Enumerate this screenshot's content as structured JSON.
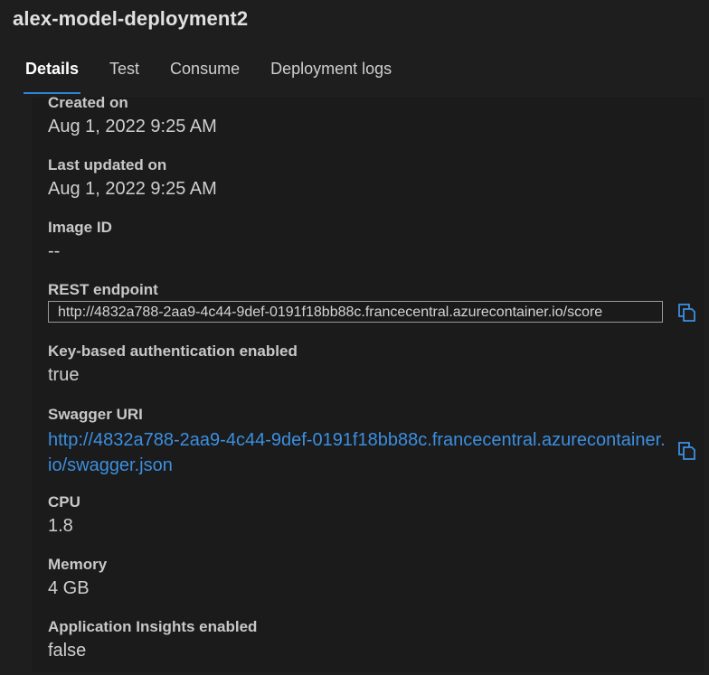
{
  "header": {
    "title": "alex-model-deployment2"
  },
  "tabs": [
    {
      "label": "Details"
    },
    {
      "label": "Test"
    },
    {
      "label": "Consume"
    },
    {
      "label": "Deployment logs"
    }
  ],
  "fields": {
    "created_on": {
      "label": "Created on",
      "value": "Aug 1, 2022 9:25 AM"
    },
    "last_updated": {
      "label": "Last updated on",
      "value": "Aug 1, 2022 9:25 AM"
    },
    "image_id": {
      "label": "Image ID",
      "value": "--"
    },
    "rest_endpoint": {
      "label": "REST endpoint",
      "value": "http://4832a788-2aa9-4c44-9def-0191f18bb88c.francecentral.azurecontainer.io/score"
    },
    "key_auth": {
      "label": "Key-based authentication enabled",
      "value": "true"
    },
    "swagger": {
      "label": "Swagger URI",
      "value": "http://4832a788-2aa9-4c44-9def-0191f18bb88c.francecentral.azurecontainer.io/swagger.json"
    },
    "cpu": {
      "label": "CPU",
      "value": "1.8"
    },
    "memory": {
      "label": "Memory",
      "value": "4 GB"
    },
    "app_insights": {
      "label": "Application Insights enabled",
      "value": "false"
    }
  },
  "icons": {
    "copy": "copy-icon"
  },
  "colors": {
    "accent": "#2f82d8",
    "link": "#3c8fe0",
    "background": "#1e1e1e"
  }
}
